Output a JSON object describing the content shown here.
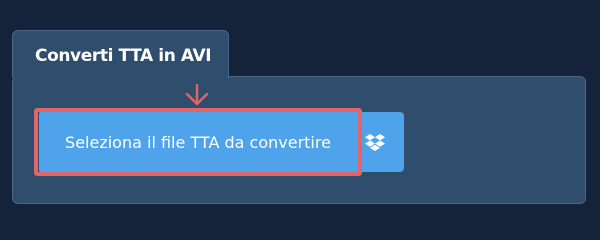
{
  "converter": {
    "tab_title": "Converti TTA in AVI",
    "select_button_label": "Seleziona il file TTA da convertire",
    "dropbox_icon": "dropbox-icon"
  },
  "colors": {
    "background": "#14233a",
    "panel": "#2f4d6d",
    "button": "#4fa3ea",
    "highlight": "#e06468"
  }
}
